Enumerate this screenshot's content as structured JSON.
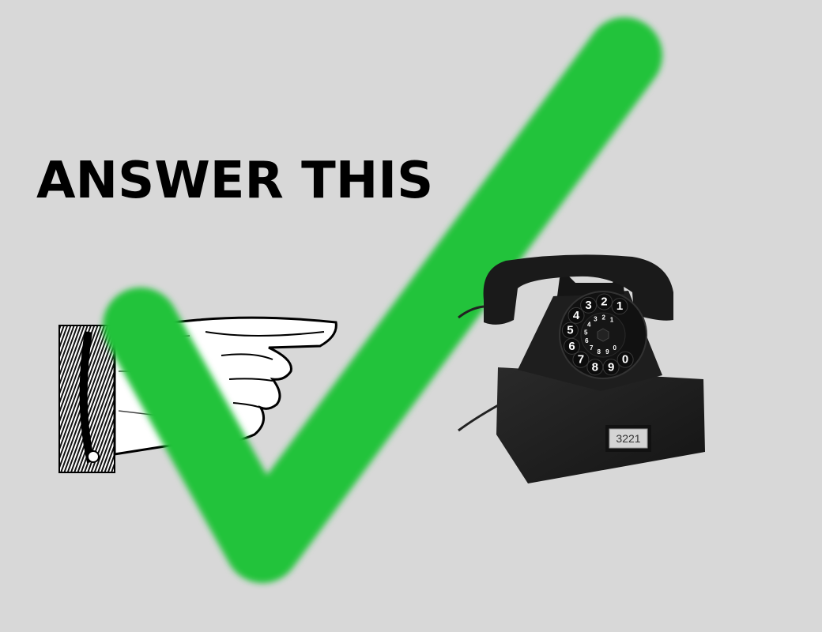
{
  "headline": "ANSWER THIS",
  "phone": {
    "number_plate": "3221",
    "dial_digits": [
      "1",
      "2",
      "3",
      "4",
      "5",
      "6",
      "7",
      "8",
      "9",
      "0"
    ]
  },
  "colors": {
    "background": "#d8d8d8",
    "checkmark": "#22c33a",
    "phone_body": "#1c1c1c"
  },
  "icons": [
    "pointing-hand-icon",
    "checkmark-icon",
    "rotary-telephone-icon"
  ]
}
